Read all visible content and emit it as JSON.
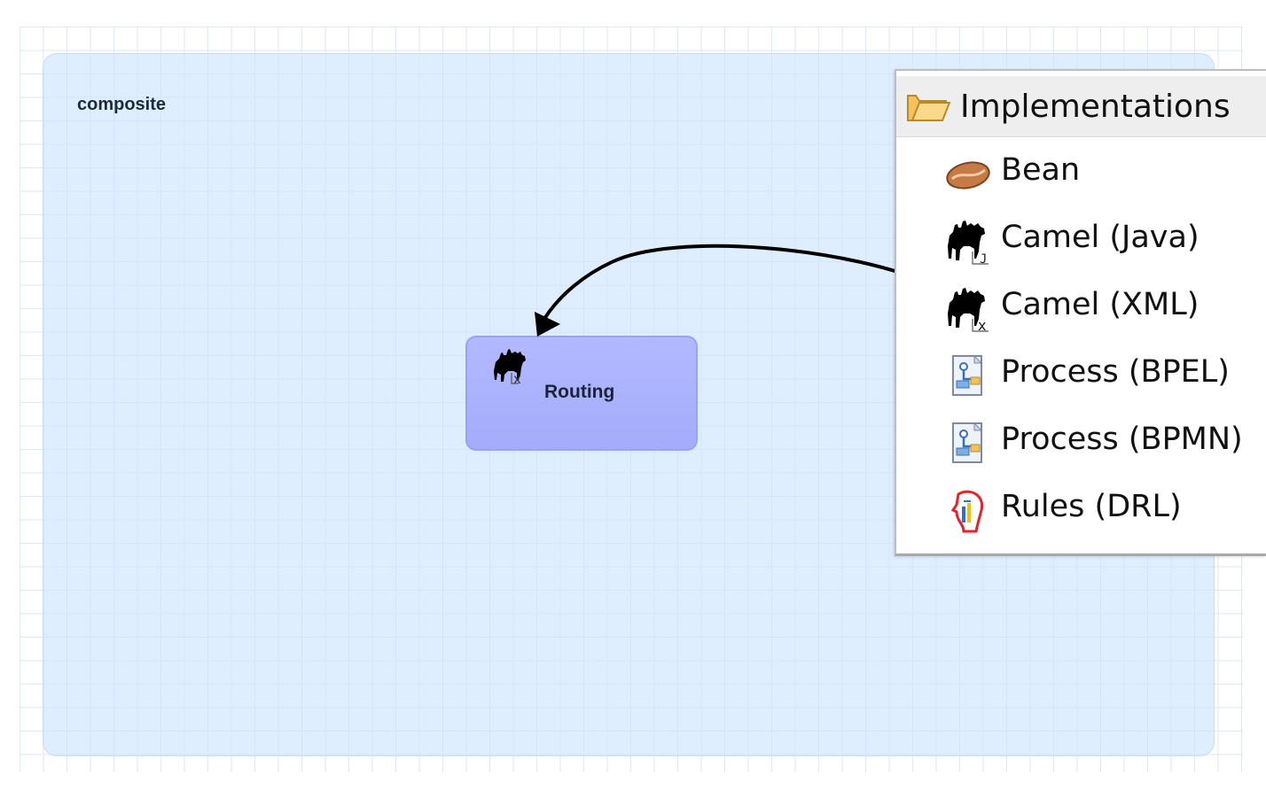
{
  "diagram": {
    "composite_label": "composite",
    "component": {
      "label": "Routing",
      "icon": "camel-xml-icon"
    }
  },
  "palette": {
    "header": {
      "title": "Implementations",
      "icon": "folder-open-icon"
    },
    "items": [
      {
        "label": "Bean",
        "icon": "bean-icon"
      },
      {
        "label": "Camel (Java)",
        "icon": "camel-java-icon"
      },
      {
        "label": "Camel (XML)",
        "icon": "camel-xml-icon"
      },
      {
        "label": "Process (BPEL)",
        "icon": "process-icon"
      },
      {
        "label": "Process (BPMN)",
        "icon": "process-icon"
      },
      {
        "label": "Rules (DRL)",
        "icon": "rules-icon"
      }
    ]
  },
  "colors": {
    "composite_fill": "#cce4ff",
    "component_fill": "#b3b9ff",
    "palette_header": "#eeeeee"
  }
}
